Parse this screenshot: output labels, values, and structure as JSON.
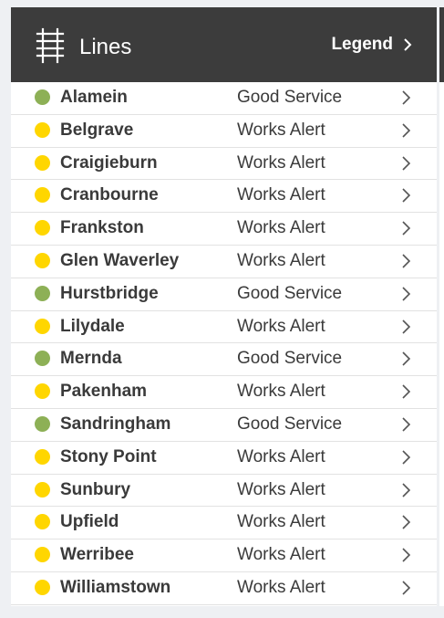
{
  "header": {
    "title": "Lines",
    "legend_label": "Legend",
    "icon": "railway-track-icon",
    "background": "#3c3c3c"
  },
  "status_colors": {
    "Good Service": "#8db056",
    "Works Alert": "#ffd600"
  },
  "lines": [
    {
      "name": "Alamein",
      "status": "Good Service"
    },
    {
      "name": "Belgrave",
      "status": "Works Alert"
    },
    {
      "name": "Craigieburn",
      "status": "Works Alert"
    },
    {
      "name": "Cranbourne",
      "status": "Works Alert"
    },
    {
      "name": "Frankston",
      "status": "Works Alert"
    },
    {
      "name": "Glen Waverley",
      "status": "Works Alert"
    },
    {
      "name": "Hurstbridge",
      "status": "Good Service"
    },
    {
      "name": "Lilydale",
      "status": "Works Alert"
    },
    {
      "name": "Mernda",
      "status": "Good Service"
    },
    {
      "name": "Pakenham",
      "status": "Works Alert"
    },
    {
      "name": "Sandringham",
      "status": "Good Service"
    },
    {
      "name": "Stony Point",
      "status": "Works Alert"
    },
    {
      "name": "Sunbury",
      "status": "Works Alert"
    },
    {
      "name": "Upfield",
      "status": "Works Alert"
    },
    {
      "name": "Werribee",
      "status": "Works Alert"
    },
    {
      "name": "Williamstown",
      "status": "Works Alert"
    }
  ]
}
